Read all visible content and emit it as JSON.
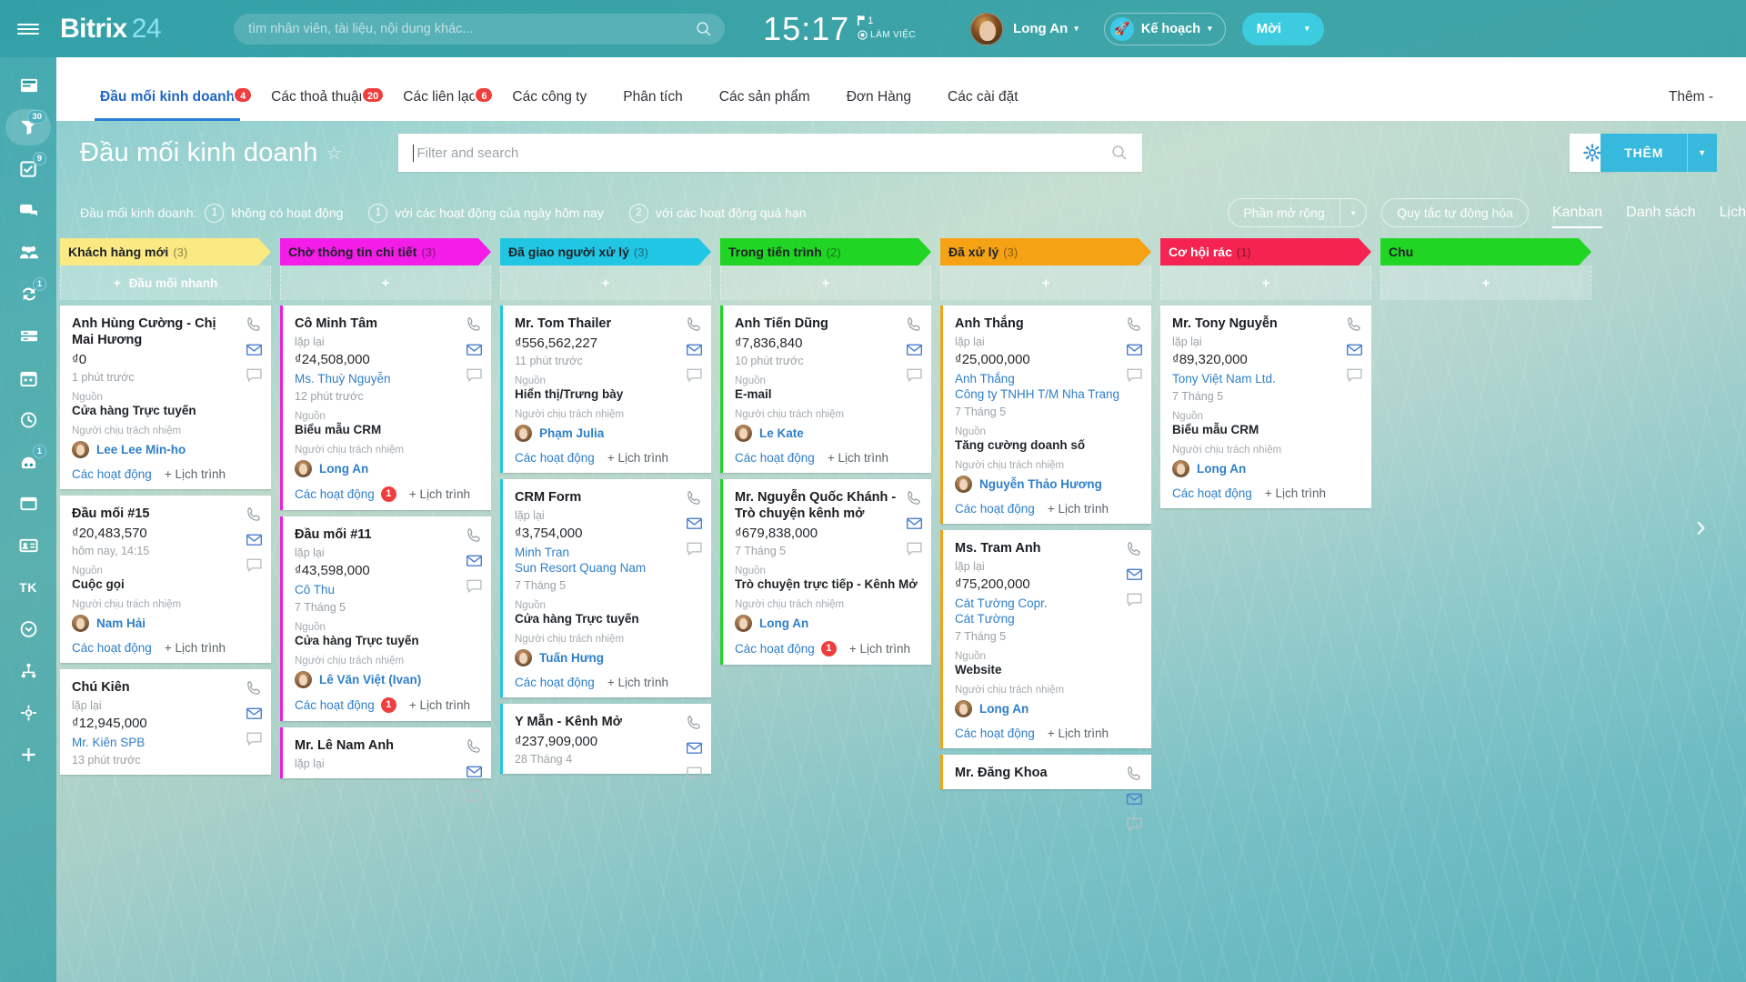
{
  "brand": {
    "name": "Bitrix",
    "num": "24"
  },
  "search": {
    "placeholder": "tìm nhân viên, tài liệu, nội dung khác...",
    "icon": "search-icon"
  },
  "clock": {
    "time": "15:17",
    "flag_count": "1",
    "status": "LÀM VIỆC"
  },
  "user": {
    "name": "Long An",
    "caret": "▾"
  },
  "header_buttons": {
    "plan_label": "Kế hoạch",
    "plan_icon": "rocket-icon",
    "plan_caret": "▾",
    "invite_label": "Mời",
    "invite_caret": "▾"
  },
  "sidebar": {
    "items": [
      {
        "name": "sidebar-item-feed",
        "icon": "feed-icon",
        "badge": ""
      },
      {
        "name": "sidebar-item-crm",
        "icon": "funnel-icon",
        "badge": "30",
        "active": true
      },
      {
        "name": "sidebar-item-tasks",
        "icon": "checkbox-icon",
        "badge": "9"
      },
      {
        "name": "sidebar-item-chat",
        "icon": "chat-icon",
        "badge": ""
      },
      {
        "name": "sidebar-item-groups",
        "icon": "people-icon",
        "badge": ""
      },
      {
        "name": "sidebar-item-automation",
        "icon": "refresh-icon",
        "badge": "1"
      },
      {
        "name": "sidebar-item-drive",
        "icon": "drive-icon",
        "badge": ""
      },
      {
        "name": "sidebar-item-calendar",
        "icon": "calendar-icon",
        "badge": ""
      },
      {
        "name": "sidebar-item-timeman",
        "icon": "clock-icon",
        "badge": ""
      },
      {
        "name": "sidebar-item-bots",
        "icon": "robot-icon",
        "badge": "1"
      },
      {
        "name": "sidebar-item-sites",
        "icon": "window-icon",
        "badge": ""
      },
      {
        "name": "sidebar-item-contacts",
        "icon": "contact-card-icon",
        "badge": ""
      },
      {
        "name": "sidebar-item-tk",
        "text": "TK",
        "badge": ""
      },
      {
        "name": "sidebar-item-more",
        "icon": "chevron-down-circle-icon",
        "badge": ""
      },
      {
        "name": "sidebar-item-sitemap",
        "icon": "sitemap-icon",
        "badge": ""
      },
      {
        "name": "sidebar-item-settings",
        "icon": "gear-icon",
        "badge": ""
      },
      {
        "name": "sidebar-item-add",
        "icon": "plus-icon",
        "badge": ""
      }
    ]
  },
  "nav": {
    "tabs": [
      {
        "label": "Đầu mối kinh doanh",
        "badge": "4",
        "active": true
      },
      {
        "label": "Các thoả thuận",
        "badge": "20",
        "active": false
      },
      {
        "label": "Các liên lạc",
        "badge": "6",
        "active": false
      },
      {
        "label": "Các công ty",
        "badge": "",
        "active": false
      },
      {
        "label": "Phân tích",
        "badge": "",
        "active": false
      },
      {
        "label": "Các sản phẩm",
        "badge": "",
        "active": false
      },
      {
        "label": "Đơn Hàng",
        "badge": "",
        "active": false
      },
      {
        "label": "Các cài đặt",
        "badge": "",
        "active": false
      }
    ],
    "more_label": "Thêm -"
  },
  "page": {
    "title": "Đầu mối kinh doanh",
    "star_icon": "star-outline-icon",
    "filter_placeholder": "Filter and search",
    "filter_value": "",
    "gear_icon": "gear-icon",
    "add_label": "THÊM",
    "add_caret": "▾"
  },
  "chips": {
    "label": "Đầu mối kinh doanh:",
    "items": [
      {
        "count": "1",
        "text": "không có hoạt động"
      },
      {
        "count": "1",
        "text": "với các hoạt động của ngày hôm nay"
      },
      {
        "count": "2",
        "text": "với các hoạt động quá hạn"
      }
    ],
    "expand_label": "Phần mở rộng",
    "expand_caret": "▾",
    "automation_label": "Quy tắc tự động hóa",
    "views": [
      {
        "label": "Kanban",
        "active": true
      },
      {
        "label": "Danh sách",
        "active": false
      },
      {
        "label": "Lịch",
        "active": false
      }
    ]
  },
  "kanban": {
    "quick_add_label": "Đầu mối nhanh",
    "plus": "+",
    "columns": [
      {
        "name": "Khách hàng mới",
        "count": "(3)",
        "color": "#fbe983",
        "text_color": "#1d2126",
        "bar": "",
        "cards": [
          {
            "title": "Anh Hùng Cường - Chị Mai Hương",
            "sub": "",
            "amount": "₫0",
            "link": "",
            "time": "1 phút trước",
            "source_label": "Nguồn",
            "source_value": "Cửa hàng Trực tuyến",
            "owner_label": "Người chịu trách nhiệm",
            "owner": "Lee Lee Min-ho",
            "activities": "Các hoạt động",
            "activity_badge": "",
            "schedule": "+ Lịch trình"
          },
          {
            "title": "Đầu mối #15",
            "sub": "",
            "amount": "₫20,483,570",
            "link": "",
            "time": "hôm nay, 14:15",
            "source_label": "Nguồn",
            "source_value": "Cuộc gọi",
            "owner_label": "Người chịu trách nhiệm",
            "owner": "Nam Hải",
            "activities": "Các hoạt động",
            "activity_badge": "",
            "schedule": "+ Lịch trình"
          },
          {
            "title": "Chú Kiên",
            "sub": "lặp lại",
            "amount": "₫12,945,000",
            "link": "Mr. Kiên SPB",
            "time": "13 phút trước",
            "source_label": "",
            "source_value": "",
            "owner_label": "",
            "owner": "",
            "activities": "",
            "activity_badge": "",
            "schedule": ""
          }
        ]
      },
      {
        "name": "Chờ thông tin chi tiết",
        "count": "(3)",
        "color": "#f41ce8",
        "text_color": "#1d2126",
        "bar": "bar-pink",
        "cards": [
          {
            "title": "Cô Minh Tâm",
            "sub": "lặp lại",
            "amount": "₫24,508,000",
            "link": "Ms. Thuỳ Nguyễn",
            "time": "12 phút trước",
            "source_label": "Nguồn",
            "source_value": "Biểu mẫu CRM",
            "owner_label": "Người chịu trách nhiệm",
            "owner": "Long An",
            "activities": "Các hoạt động",
            "activity_badge": "1",
            "schedule": "+ Lịch trình"
          },
          {
            "title": "Đầu mối #11",
            "sub": "lặp lại",
            "amount": "₫43,598,000",
            "link": "Cô Thu",
            "time": "7 Tháng 5",
            "source_label": "Nguồn",
            "source_value": "Cửa hàng Trực tuyến",
            "owner_label": "Người chịu trách nhiệm",
            "owner": "Lê Văn Việt (Ivan)",
            "activities": "Các hoạt động",
            "activity_badge": "1",
            "schedule": "+ Lịch trình"
          },
          {
            "title": "Mr. Lê Nam Anh",
            "sub": "lặp lại",
            "amount": "",
            "link": "",
            "time": "",
            "source_label": "",
            "source_value": "",
            "owner_label": "",
            "owner": "",
            "activities": "",
            "activity_badge": "",
            "schedule": ""
          }
        ]
      },
      {
        "name": "Đã giao người xử lý",
        "count": "(3)",
        "color": "#21c6e4",
        "text_color": "#1d2126",
        "bar": "bar-cyan",
        "cards": [
          {
            "title": "Mr. Tom Thailer",
            "sub": "",
            "amount": "₫556,562,227",
            "link": "",
            "time": "11 phút trước",
            "source_label": "Nguồn",
            "source_value": "Hiển thị/Trưng bày",
            "owner_label": "Người chịu trách nhiệm",
            "owner": "Phạm Julia",
            "activities": "Các hoạt động",
            "activity_badge": "",
            "schedule": "+ Lịch trình"
          },
          {
            "title": "CRM Form",
            "sub": "lặp lại",
            "amount": "₫3,754,000",
            "link": "Minh Tran\nSun Resort Quang Nam",
            "time": "7 Tháng 5",
            "source_label": "Nguồn",
            "source_value": "Cửa hàng Trực tuyến",
            "owner_label": "Người chịu trách nhiệm",
            "owner": "Tuấn Hưng",
            "activities": "Các hoạt động",
            "activity_badge": "",
            "schedule": "+ Lịch trình"
          },
          {
            "title": "Y Mẫn - Kênh Mở",
            "sub": "",
            "amount": "₫237,909,000",
            "link": "",
            "time": "28 Tháng 4",
            "source_label": "",
            "source_value": "",
            "owner_label": "",
            "owner": "",
            "activities": "",
            "activity_badge": "",
            "schedule": ""
          }
        ]
      },
      {
        "name": "Trong tiến trình",
        "count": "(2)",
        "color": "#20d523",
        "text_color": "#1d2126",
        "bar": "bar-green",
        "cards": [
          {
            "title": "Anh Tiến Dũng",
            "sub": "",
            "amount": "₫7,836,840",
            "link": "",
            "time": "10 phút trước",
            "source_label": "Nguồn",
            "source_value": "E-mail",
            "owner_label": "Người chịu trách nhiệm",
            "owner": "Le Kate",
            "activities": "Các hoạt động",
            "activity_badge": "",
            "schedule": "+ Lịch trình"
          },
          {
            "title": "Mr. Nguyễn Quốc Khánh - Trò chuyện kênh mở",
            "sub": "",
            "amount": "₫679,838,000",
            "link": "",
            "time": "7 Tháng 5",
            "source_label": "Nguồn",
            "source_value": "Trò chuyện trực tiếp - Kênh Mở",
            "owner_label": "Người chịu trách nhiệm",
            "owner": "Long An",
            "activities": "Các hoạt động",
            "activity_badge": "1",
            "schedule": "+ Lịch trình"
          }
        ]
      },
      {
        "name": "Đã xử lý",
        "count": "(3)",
        "color": "#f5a214",
        "text_color": "#1d2126",
        "bar": "bar-orange",
        "cards": [
          {
            "title": "Anh Thắng",
            "sub": "lặp lại",
            "amount": "₫25,000,000",
            "link": "Anh Thắng\nCông ty TNHH T/M Nha Trang",
            "time": "7 Tháng 5",
            "source_label": "Nguồn",
            "source_value": "Tăng cường doanh số",
            "owner_label": "Người chịu trách nhiệm",
            "owner": "Nguyễn Thảo Hương",
            "activities": "Các hoạt động",
            "activity_badge": "",
            "schedule": "+ Lịch trình"
          },
          {
            "title": "Ms. Tram Anh",
            "sub": "lặp lại",
            "amount": "₫75,200,000",
            "link": "Cát Tường Copr.\nCát Tường",
            "time": "7 Tháng 5",
            "source_label": "Nguồn",
            "source_value": "Website",
            "owner_label": "Người chịu trách nhiệm",
            "owner": "Long An",
            "activities": "Các hoạt động",
            "activity_badge": "",
            "schedule": "+ Lịch trình"
          },
          {
            "title": "Mr. Đăng Khoa",
            "sub": "",
            "amount": "",
            "link": "",
            "time": "",
            "source_label": "",
            "source_value": "",
            "owner_label": "",
            "owner": "",
            "activities": "",
            "activity_badge": "",
            "schedule": ""
          }
        ]
      },
      {
        "name": "Cơ hội rác",
        "count": "(1)",
        "color": "#f4234f",
        "text_color": "#ffffff",
        "bar": "",
        "cards": [
          {
            "title": "Mr. Tony Nguyễn",
            "sub": "lặp lại",
            "amount": "₫89,320,000",
            "link": "Tony Việt Nam Ltd.",
            "time": "7 Tháng 5",
            "source_label": "Nguồn",
            "source_value": "Biểu mẫu CRM",
            "owner_label": "Người chịu trách nhiệm",
            "owner": "Long An",
            "activities": "Các hoạt động",
            "activity_badge": "",
            "schedule": "+ Lịch trình"
          }
        ]
      },
      {
        "name": "Chu",
        "count": "",
        "color": "#20d523",
        "text_color": "#1d2126",
        "bar": "",
        "cards": []
      }
    ]
  },
  "icons": {
    "phone": "phone-icon",
    "mail": "mail-icon",
    "comment": "comment-icon",
    "next_arrow": "chevron-right-icon",
    "prev_arrow": "chevron-left-icon"
  }
}
